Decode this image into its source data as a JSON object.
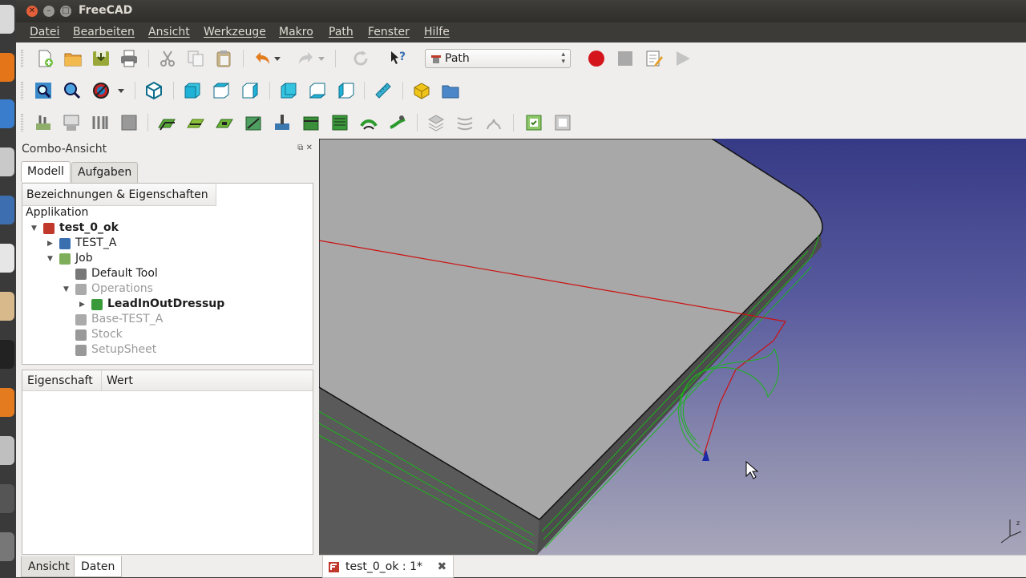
{
  "window": {
    "title": "FreeCAD"
  },
  "menu": [
    "Datei",
    "Bearbeiten",
    "Ansicht",
    "Werkzeuge",
    "Makro",
    "Path",
    "Fenster",
    "Hilfe"
  ],
  "workbench": {
    "selected": "Path"
  },
  "combo": {
    "title": "Combo-Ansicht",
    "tabs": [
      "Modell",
      "Aufgaben"
    ],
    "tree_header": "Bezeichnungen & Eigenschaften",
    "root": "Applikation",
    "items": [
      {
        "label": "test_0_ok",
        "icon": "document-icon",
        "bold": true,
        "expander": "open"
      },
      {
        "label": "TEST_A",
        "icon": "part-icon",
        "bold": false,
        "expander": "closed"
      },
      {
        "label": "Job",
        "icon": "job-icon",
        "bold": false,
        "expander": "open"
      },
      {
        "label": "Default Tool",
        "icon": "tool-icon",
        "bold": false,
        "expander": "none"
      },
      {
        "label": "Operations",
        "icon": "operations-icon",
        "bold": false,
        "expander": "open",
        "greyed": true
      },
      {
        "label": "LeadInOutDressup",
        "icon": "dressup-icon",
        "bold": true,
        "expander": "closed"
      },
      {
        "label": "Base-TEST_A",
        "icon": "base-icon",
        "bold": false,
        "expander": "none",
        "greyed": true
      },
      {
        "label": "Stock",
        "icon": "stock-icon",
        "bold": false,
        "expander": "none",
        "greyed": true
      },
      {
        "label": "SetupSheet",
        "icon": "setupsheet-icon",
        "bold": false,
        "expander": "none",
        "greyed": true
      }
    ],
    "prop_headers": [
      "Eigenschaft",
      "Wert"
    ],
    "bottom_tabs": [
      "Ansicht",
      "Daten"
    ]
  },
  "doc_tab": {
    "label": "test_0_ok : 1*"
  },
  "colors": {
    "viewport_top": "#363a85",
    "viewport_bottom": "#a7a6ba",
    "model_face": "#a8a8a8",
    "path_green": "#1bb31b",
    "path_red": "#cc1111"
  }
}
